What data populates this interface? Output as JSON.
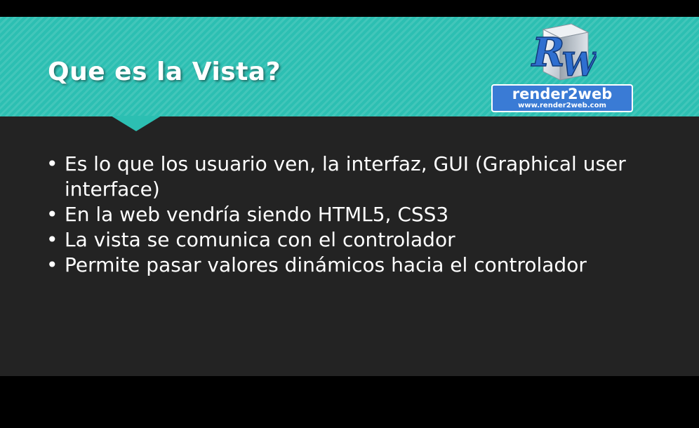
{
  "slide": {
    "title": "Que es la Vista?",
    "bullets": [
      "Es lo que los usuario ven, la interfaz, GUI (Graphical user interface)",
      "En la web vendría siendo HTML5, CSS3",
      "La vista se comunica con el controlador",
      "Permite pasar valores dinámicos hacia el controlador"
    ],
    "bullet_glyph": "•"
  },
  "logo": {
    "letters": "RW",
    "letter_r": "R",
    "letter_w": "W",
    "name": "render2web",
    "url": "www.render2web.com"
  },
  "colors": {
    "header": "#2cbfb2",
    "background": "#232323",
    "logo_banner": "#3a7bd5",
    "text": "#ffffff"
  }
}
